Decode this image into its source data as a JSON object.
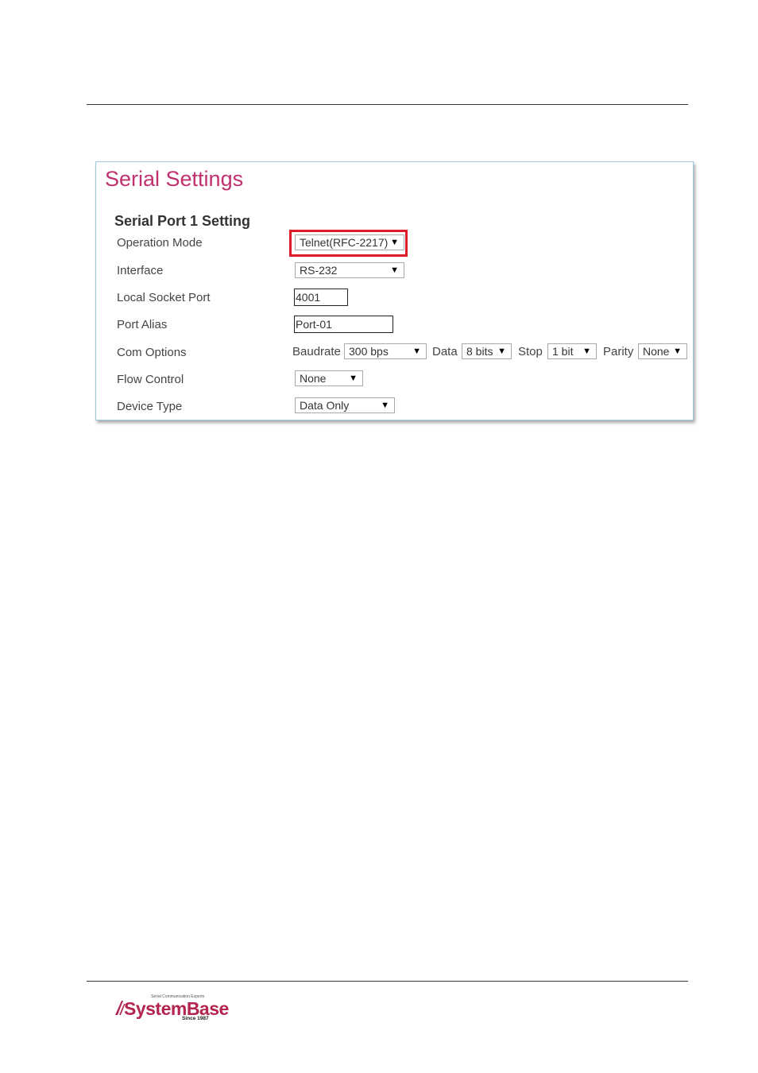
{
  "panel": {
    "title": "Serial Settings",
    "section_title": "Serial Port 1 Setting",
    "rows": {
      "operation_mode": {
        "label": "Operation Mode",
        "value": "Telnet(RFC-2217)"
      },
      "interface": {
        "label": "Interface",
        "value": "RS-232"
      },
      "local_socket_port": {
        "label": "Local Socket Port",
        "value": "4001"
      },
      "port_alias": {
        "label": "Port Alias",
        "value": "Port-01"
      },
      "com_options": {
        "label": "Com Options",
        "baudrate_label": "Baudrate",
        "baudrate_value": "300 bps",
        "data_label": "Data",
        "data_value": "8 bits",
        "stop_label": "Stop",
        "stop_value": "1 bit",
        "parity_label": "Parity",
        "parity_value": "None"
      },
      "flow_control": {
        "label": "Flow Control",
        "value": "None"
      },
      "device_type": {
        "label": "Device Type",
        "value": "Data Only"
      }
    },
    "highlight_color": "#e01b2a",
    "title_color": "#c0306e"
  },
  "footer": {
    "logo_tagline": "Serial Communication Experts",
    "logo_name": "SystemBase",
    "logo_since": "Since 1987"
  },
  "icons": {
    "dropdown": "caret-down-icon"
  }
}
